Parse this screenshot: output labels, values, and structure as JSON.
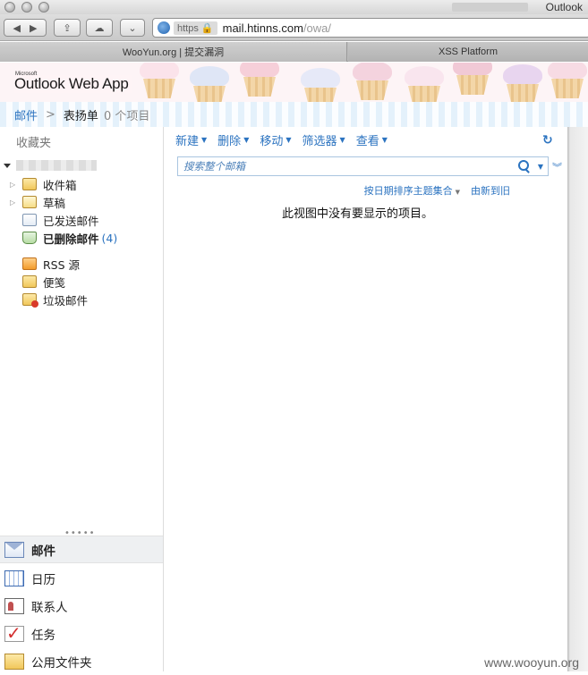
{
  "browser": {
    "window_title": "Outlook",
    "https_label": "https",
    "url_host": "mail.htinns.com",
    "url_path": "/owa/",
    "tabs": [
      "WooYun.org | 提交漏洞",
      "XSS Platform"
    ]
  },
  "owa": {
    "brand_small": "Microsoft",
    "app_name": "Outlook Web App",
    "breadcrumb": {
      "root": "邮件",
      "separator": ">",
      "folder": "表扬单",
      "count": "0 个项目"
    }
  },
  "sidebar": {
    "favorites_label": "收藏夹",
    "folders": [
      {
        "label": "收件箱",
        "icon": "inbox-folder-icon"
      },
      {
        "label": "草稿",
        "icon": "drafts-folder-icon"
      },
      {
        "label": "已发送邮件",
        "icon": "sent-folder-icon"
      },
      {
        "label": "已删除邮件",
        "icon": "deleted-folder-icon",
        "count": "(4)"
      },
      {
        "label": "RSS 源",
        "icon": "rss-folder-icon"
      },
      {
        "label": "便笺",
        "icon": "notes-folder-icon"
      },
      {
        "label": "垃圾邮件",
        "icon": "junk-folder-icon"
      }
    ],
    "nav": [
      {
        "label": "邮件",
        "icon": "mail-icon"
      },
      {
        "label": "日历",
        "icon": "calendar-icon"
      },
      {
        "label": "联系人",
        "icon": "contacts-icon"
      },
      {
        "label": "任务",
        "icon": "tasks-icon"
      },
      {
        "label": "公用文件夹",
        "icon": "public-folder-icon"
      }
    ]
  },
  "main": {
    "commands": [
      "新建",
      "删除",
      "移动",
      "筛选器",
      "查看"
    ],
    "search_placeholder": "搜索整个邮箱",
    "sort_by": "按日期排序主题集合",
    "sort_order": "由新到旧",
    "empty_message": "此视图中没有要显示的项目。"
  },
  "watermark": "www.wooyun.org"
}
